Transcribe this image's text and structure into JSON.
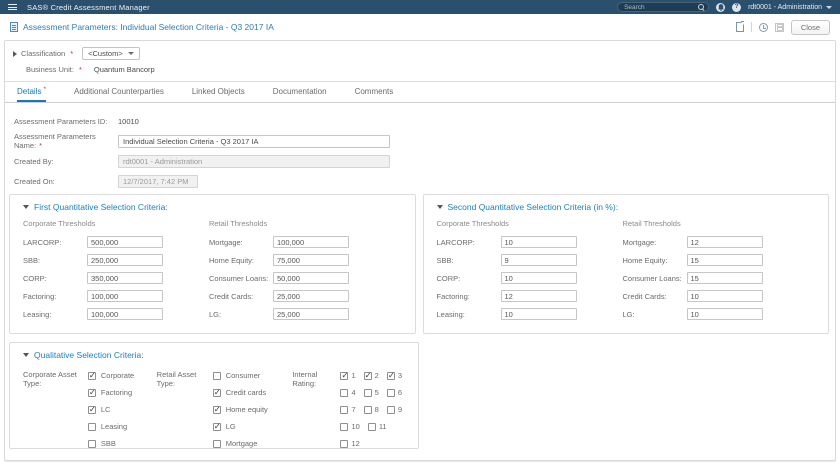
{
  "colors": {
    "topbar": "#2a506e",
    "accent_blue": "#1a80c2",
    "required_red": "#cc3333"
  },
  "topbar": {
    "brand": "SAS® Credit Assessment Manager",
    "search_placeholder": "Search",
    "help_glyph": "?",
    "user": "rdt0001 - Administration"
  },
  "titlebar": {
    "title": "Assessment Parameters: Individual Selection Criteria - Q3 2017 IA",
    "close_label": "Close"
  },
  "classification": {
    "label": "Classification",
    "value": "<Custom>",
    "business_unit_label": "Business Unit:",
    "business_unit_value": "Quantum Bancorp"
  },
  "tabs": [
    {
      "label": "Details",
      "required": true,
      "active": true
    },
    {
      "label": "Additional Counterparties",
      "required": false,
      "active": false
    },
    {
      "label": "Linked Objects",
      "required": false,
      "active": false
    },
    {
      "label": "Documentation",
      "required": false,
      "active": false
    },
    {
      "label": "Comments",
      "required": false,
      "active": false
    }
  ],
  "details_form": {
    "fields": [
      {
        "label": "Assessment Parameters ID:",
        "required": false,
        "value": "10010",
        "type": "static"
      },
      {
        "label": "Assessment Parameters Name:",
        "required": true,
        "value": "Individual Selection Criteria - Q3 2017 IA",
        "type": "input"
      },
      {
        "label": "Created By:",
        "required": false,
        "value": "rdt0001 - Administration",
        "type": "disabled"
      },
      {
        "label": "Created On:",
        "required": false,
        "value": "12/7/2017, 7:42 PM",
        "type": "disabled",
        "short": true
      }
    ]
  },
  "first_quant": {
    "title": "First Quantitative Selection Criteria:",
    "corporate_header": "Corporate Thresholds",
    "retail_header": "Retail Thresholds",
    "corporate": [
      {
        "label": "LARCORP:",
        "value": "500,000"
      },
      {
        "label": "SBB:",
        "value": "250,000"
      },
      {
        "label": "CORP:",
        "value": "350,000"
      },
      {
        "label": "Factoring:",
        "value": "100,000"
      },
      {
        "label": "Leasing:",
        "value": "100,000"
      }
    ],
    "retail": [
      {
        "label": "Mortgage:",
        "value": "100,000"
      },
      {
        "label": "Home Equity:",
        "value": "75,000"
      },
      {
        "label": "Consumer Loans:",
        "value": "50,000"
      },
      {
        "label": "Credit Cards:",
        "value": "25,000"
      },
      {
        "label": "LG:",
        "value": "25,000"
      }
    ]
  },
  "second_quant": {
    "title": "Second Quantitative Selection Criteria (in %):",
    "corporate_header": "Corporate Thresholds",
    "retail_header": "Retail Thresholds",
    "corporate": [
      {
        "label": "LARCORP:",
        "value": "10"
      },
      {
        "label": "SBB:",
        "value": "9"
      },
      {
        "label": "CORP:",
        "value": "10"
      },
      {
        "label": "Factoring:",
        "value": "12"
      },
      {
        "label": "Leasing:",
        "value": "10"
      }
    ],
    "retail": [
      {
        "label": "Mortgage:",
        "value": "12"
      },
      {
        "label": "Home Equity:",
        "value": "15"
      },
      {
        "label": "Consumer Loans:",
        "value": "15"
      },
      {
        "label": "Credit Cards:",
        "value": "10"
      },
      {
        "label": "LG:",
        "value": "10"
      }
    ]
  },
  "qualitative": {
    "title": "Qualitative Selection Criteria:",
    "corporate_label": "Corporate Asset Type:",
    "retail_label": "Retail Asset Type:",
    "rating_label": "Internal Rating:",
    "corporate_options": [
      {
        "label": "Corporate",
        "checked": true
      },
      {
        "label": "Factoring",
        "checked": true
      },
      {
        "label": "LC",
        "checked": true
      },
      {
        "label": "Leasing",
        "checked": false
      },
      {
        "label": "SBB",
        "checked": false
      }
    ],
    "retail_options": [
      {
        "label": "Consumer",
        "checked": false
      },
      {
        "label": "Credit cards",
        "checked": true
      },
      {
        "label": "Home equity",
        "checked": true
      },
      {
        "label": "LG",
        "checked": true
      },
      {
        "label": "Mortgage",
        "checked": false
      }
    ],
    "rating_rows": [
      [
        {
          "label": "1",
          "checked": true
        },
        {
          "label": "2",
          "checked": true
        },
        {
          "label": "3",
          "checked": true
        }
      ],
      [
        {
          "label": "4",
          "checked": false
        },
        {
          "label": "5",
          "checked": false
        },
        {
          "label": "6",
          "checked": false
        }
      ],
      [
        {
          "label": "7",
          "checked": false
        },
        {
          "label": "8",
          "checked": false
        },
        {
          "label": "9",
          "checked": false
        }
      ],
      [
        {
          "label": "10",
          "checked": false
        },
        {
          "label": "11",
          "checked": false
        }
      ],
      [
        {
          "label": "12",
          "checked": false
        }
      ]
    ]
  }
}
